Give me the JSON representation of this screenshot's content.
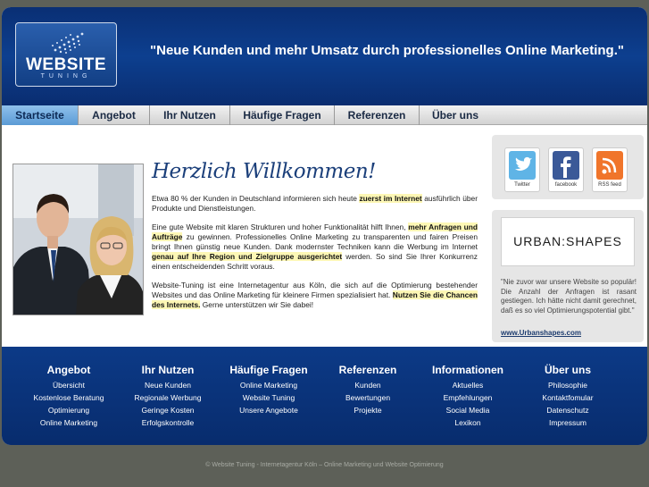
{
  "header": {
    "logo_word": "WEBSITE",
    "logo_sub": "TUNING",
    "tagline": "\"Neue Kunden und mehr Umsatz durch professionelles Online Marketing.\""
  },
  "nav": {
    "items": [
      {
        "label": "Startseite",
        "active": true
      },
      {
        "label": "Angebot"
      },
      {
        "label": "Ihr Nutzen"
      },
      {
        "label": "Häufige Fragen"
      },
      {
        "label": "Referenzen"
      },
      {
        "label": "Über uns"
      }
    ]
  },
  "main": {
    "welcome": "Herzlich Willkommen!",
    "p1": {
      "a": "Etwa 80 % der Kunden in Deutschland informieren sich heute ",
      "hl": "zuerst im Internet",
      "b": " ausführlich über Produkte und Dienstleistungen."
    },
    "p2": {
      "a": "Eine gute Website mit klaren Strukturen und hoher Funktionalität hilft Ihnen, ",
      "hl1": "mehr Anfragen und Aufträge",
      "b": " zu gewinnen. Professionelles Online Marketing zu transparenten und fairen Preisen bringt Ihnen günstig neue Kunden. Dank modernster Techniken kann die Werbung im Internet ",
      "hl2": "genau auf Ihre Region und Zielgruppe ausgerichtet",
      "c": " werden. So sind Sie Ihrer Konkurrenz einen entscheidenden Schritt voraus."
    },
    "p3": {
      "a": "Website-Tuning ist eine Internetagentur aus Köln, die sich auf die Optimierung bestehender Websites und das Online Marketing für kleinere Firmen spezialisiert hat. ",
      "hl": "Nutzen Sie die Chancen des Internets.",
      "b": " Gerne unterstützen wir Sie dabei!"
    }
  },
  "sidebar": {
    "social": [
      {
        "label": "Twitter",
        "icon": "twitter-icon",
        "color": "#5fb4e6"
      },
      {
        "label": "facebook",
        "icon": "facebook-icon",
        "color": "#3b5998"
      },
      {
        "label": "RSS feed",
        "icon": "rss-icon",
        "color": "#f0752b"
      }
    ],
    "brand": "URBAN:SHAPES",
    "quote": "\"Nie zuvor war unsere Website so populär! Die Anzahl der Anfragen ist rasant gestiegen. Ich hätte nicht damit gerechnet, daß es so viel Optimierungspotential gibt.\"",
    "quote_link": "www.Urbanshapes.com"
  },
  "footer": {
    "columns": [
      {
        "title": "Angebot",
        "links": [
          "Übersicht",
          "Kostenlose Beratung",
          "Optimierung",
          "Online Marketing"
        ]
      },
      {
        "title": "Ihr Nutzen",
        "links": [
          "Neue Kunden",
          "Regionale Werbung",
          "Geringe Kosten",
          "Erfolgskontrolle"
        ]
      },
      {
        "title": "Häufige Fragen",
        "links": [
          "Online Marketing",
          "Website Tuning",
          "Unsere Angebote"
        ]
      },
      {
        "title": "Referenzen",
        "links": [
          "Kunden",
          "Bewertungen",
          "Projekte"
        ]
      },
      {
        "title": "Informationen",
        "links": [
          "Aktuelles",
          "Empfehlungen",
          "Social Media",
          "Lexikon"
        ]
      },
      {
        "title": "Über uns",
        "links": [
          "Philosophie",
          "Kontaktfomular",
          "Datenschutz",
          "Impressum"
        ]
      }
    ],
    "copyright": "© Website Tuning - Internetagentur Köln – Online Marketing und Website Optimierung"
  }
}
